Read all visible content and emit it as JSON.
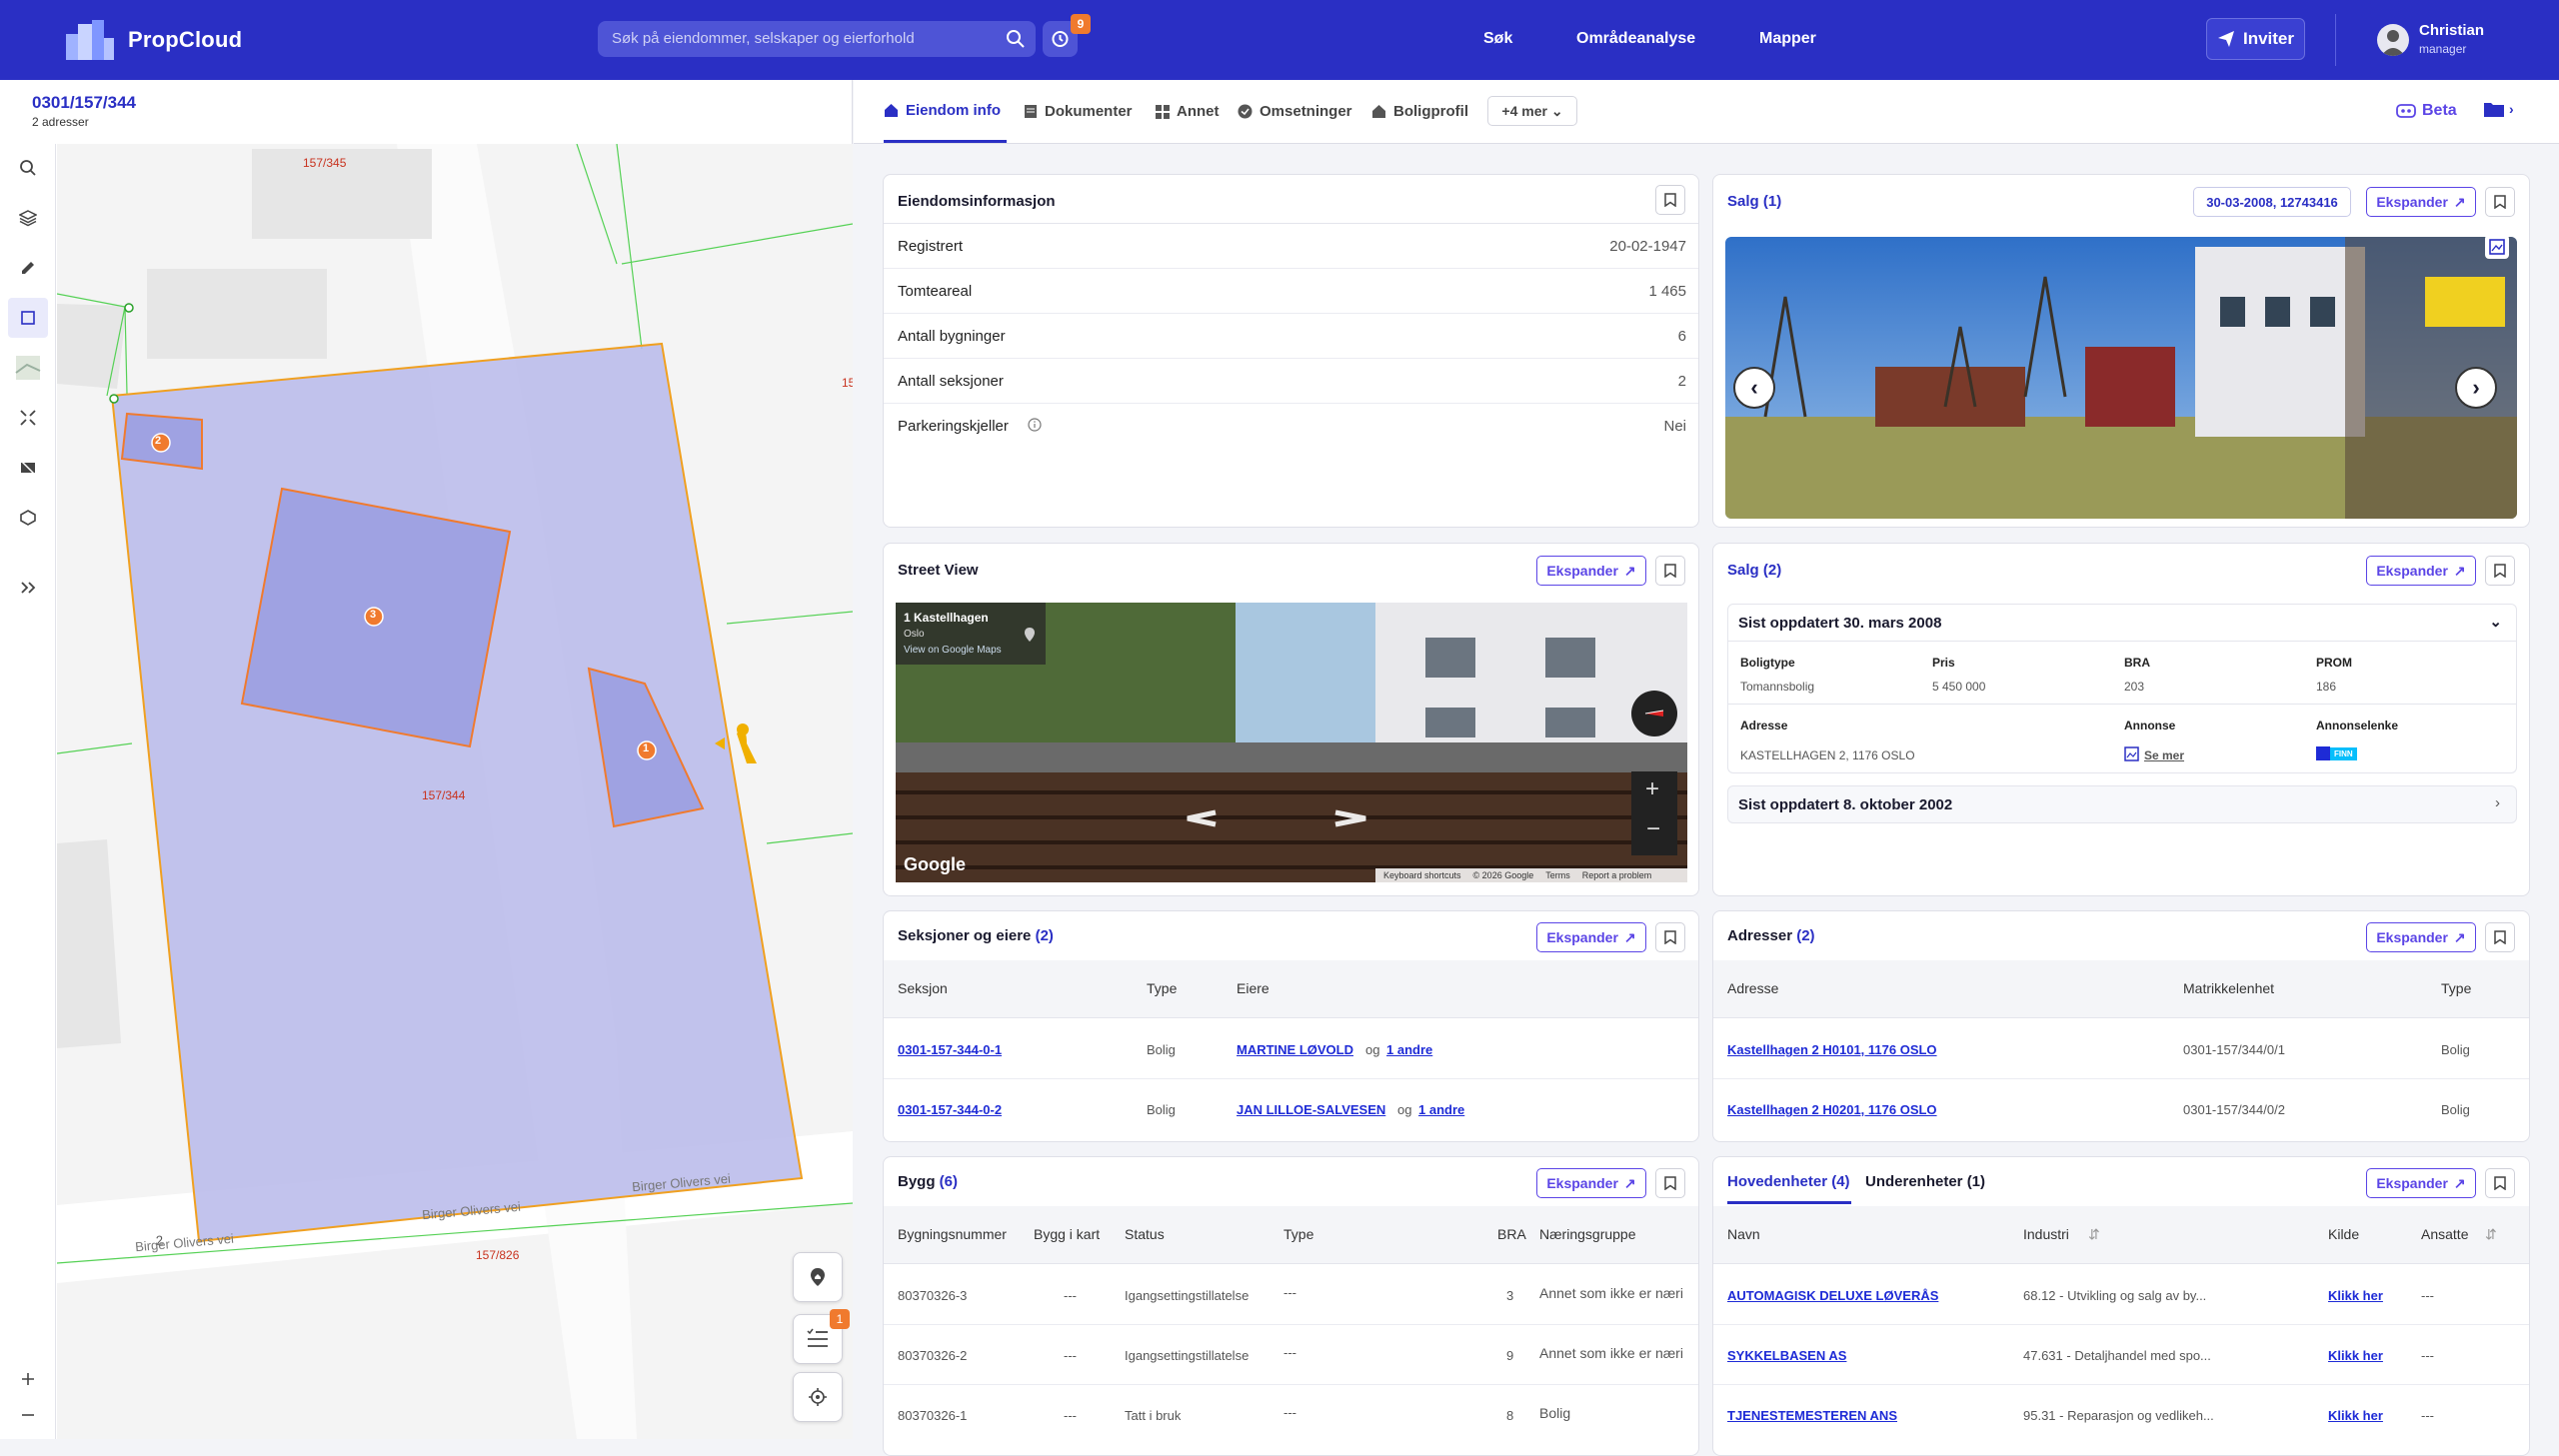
{
  "app": {
    "name": "PropCloud"
  },
  "header": {
    "search_placeholder": "Søk på eiendommer, selskaper og eierforhold",
    "history_badge": "9",
    "nav": [
      "Søk",
      "Områdeanalyse",
      "Mapper"
    ],
    "invite_label": "Inviter",
    "user": {
      "name": "Christian",
      "role": "manager"
    }
  },
  "property": {
    "id": "0301/157/344",
    "subtitle": "2 adresser"
  },
  "map": {
    "parcel_labels": [
      "157/345",
      "157/344",
      "157/826",
      "15"
    ],
    "road_labels": [
      "Birger Olivers vei",
      "Birger Olivers vei",
      "Birger Olivers vei"
    ],
    "building_markers": [
      "2",
      "3",
      "1"
    ],
    "list_badge": "1"
  },
  "tabs": {
    "items": [
      "Eiendom info",
      "Dokumenter",
      "Annet",
      "Omsetninger",
      "Boligprofil"
    ],
    "more": "+4 mer",
    "beta": "Beta"
  },
  "common": {
    "expand": "Ekspander"
  },
  "eiendomsinfo": {
    "title": "Eiendomsinformasjon",
    "rows": [
      {
        "k": "Registrert",
        "v": "20-02-1947"
      },
      {
        "k": "Tomteareal",
        "v": "1 465"
      },
      {
        "k": "Antall bygninger",
        "v": "6"
      },
      {
        "k": "Antall seksjoner",
        "v": "2"
      },
      {
        "k": "Parkeringskjeller",
        "v": "Nei"
      }
    ]
  },
  "salg1": {
    "title": "Salg",
    "count": "(1)",
    "ref": "30-03-2008, 12743416"
  },
  "streetview": {
    "title": "Street View",
    "address": "1 Kastellhagen",
    "city": "Oslo",
    "maps_link": "View on Google Maps",
    "google": "Google",
    "footer": [
      "Keyboard shortcuts",
      "© 2026 Google",
      "Terms",
      "Report a problem"
    ]
  },
  "salg2": {
    "title": "Salg",
    "count": "(2)",
    "updated1": "Sist oppdatert 30. mars 2008",
    "labels": {
      "boligtype": "Boligtype",
      "pris": "Pris",
      "bra": "BRA",
      "prom": "PROM",
      "adresse": "Adresse",
      "annonse": "Annonse",
      "annonselenke": "Annonselenke"
    },
    "values": {
      "boligtype": "Tomannsbolig",
      "pris": "5 450 000",
      "bra": "203",
      "prom": "186",
      "adresse": "KASTELLHAGEN 2, 1176 OSLO",
      "annonse": "Se mer",
      "finn": "FINN"
    },
    "updated2": "Sist oppdatert 8. oktober 2002"
  },
  "seksjoner": {
    "title": "Seksjoner og eiere",
    "count": "(2)",
    "cols": [
      "Seksjon",
      "Type",
      "Eiere"
    ],
    "rows": [
      {
        "seksjon": "0301-157-344-0-1",
        "type": "Bolig",
        "eier": "MARTINE LØVOLD",
        "og": "og",
        "andre": "1 andre"
      },
      {
        "seksjon": "0301-157-344-0-2",
        "type": "Bolig",
        "eier": "JAN LILLOE-SALVESEN",
        "og": "og",
        "andre": "1 andre"
      }
    ]
  },
  "adresser": {
    "title": "Adresser",
    "count": "(2)",
    "cols": [
      "Adresse",
      "Matrikkelenhet",
      "Type"
    ],
    "rows": [
      {
        "adresse": "Kastellhagen 2 H0101, 1176 OSLO",
        "matr": "0301-157/344/0/1",
        "type": "Bolig"
      },
      {
        "adresse": "Kastellhagen 2 H0201, 1176 OSLO",
        "matr": "0301-157/344/0/2",
        "type": "Bolig"
      }
    ]
  },
  "bygg": {
    "title": "Bygg",
    "count": "(6)",
    "cols": [
      "Bygningsnummer",
      "Bygg i kart",
      "Status",
      "Type",
      "BRA",
      "Næringsgruppe"
    ],
    "rows": [
      {
        "nr": "80370326-3",
        "kart": "---",
        "status": "Igangsettingstillatelse",
        "type": "---",
        "bra": "3",
        "gruppe": "Annet som ikke er næri"
      },
      {
        "nr": "80370326-2",
        "kart": "---",
        "status": "Igangsettingstillatelse",
        "type": "---",
        "bra": "9",
        "gruppe": "Annet som ikke er næri"
      },
      {
        "nr": "80370326-1",
        "kart": "---",
        "status": "Tatt i bruk",
        "type": "---",
        "bra": "8",
        "gruppe": "Bolig"
      }
    ]
  },
  "enheter": {
    "tab1": "Hovedenheter (4)",
    "tab2": "Underenheter (1)",
    "cols": [
      "Navn",
      "Industri",
      "Kilde",
      "Ansatte"
    ],
    "rows": [
      {
        "navn": "AUTOMAGISK DELUXE LØVERÅS",
        "industri": "68.12 - Utvikling og salg av by...",
        "kilde": "Klikk her",
        "ansatte": "---"
      },
      {
        "navn": "SYKKELBASEN AS",
        "industri": "47.631 - Detaljhandel med spo...",
        "kilde": "Klikk her",
        "ansatte": "---"
      },
      {
        "navn": "TJENESTEMESTEREN ANS",
        "industri": "95.31 - Reparasjon og vedlikeh...",
        "kilde": "Klikk her",
        "ansatte": "---"
      }
    ]
  },
  "colors": {
    "brand": "#2a2fc4",
    "accent": "#5b45e6",
    "badge": "#f07a2e",
    "parcel_fill": "#b7b9ea",
    "building_stroke": "#f07a2e"
  }
}
